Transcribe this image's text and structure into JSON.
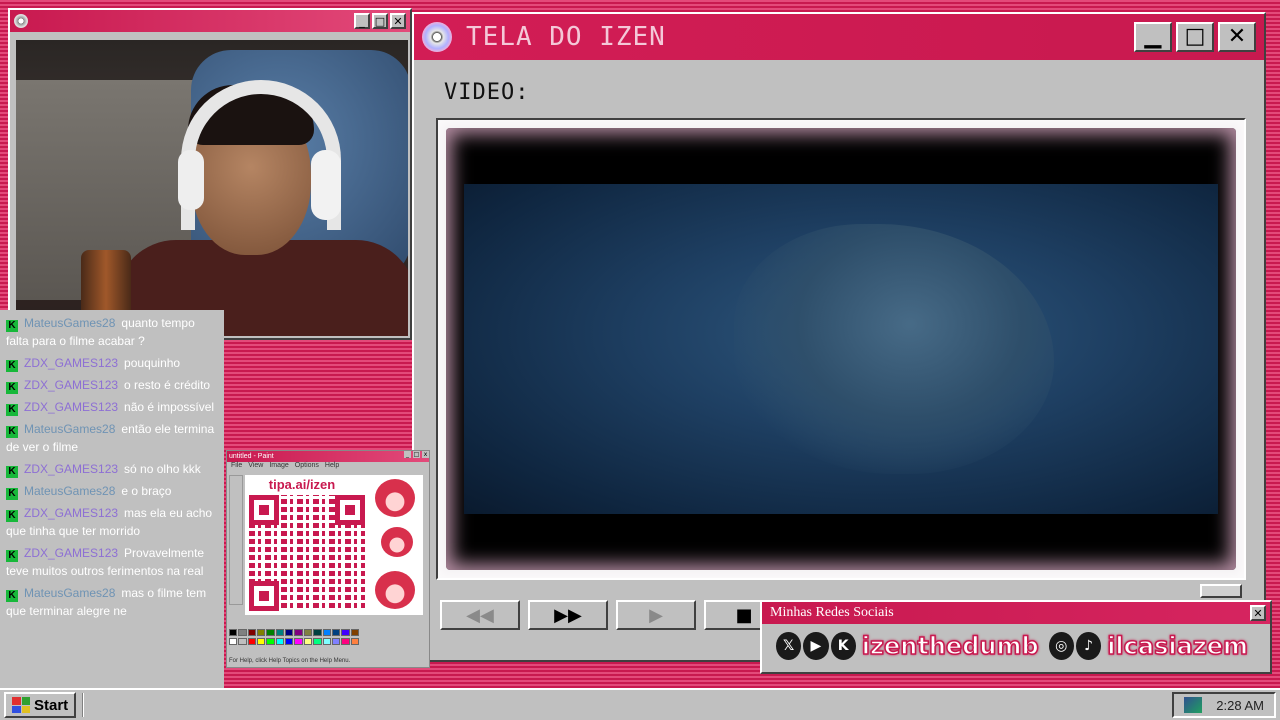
{
  "main_window": {
    "title": "TELA DO IZEN",
    "video_label": "VIDEO:",
    "controls": {
      "rewind": "◀◀",
      "fast_forward": "▶▶",
      "play": "▶",
      "stop": "■"
    }
  },
  "webcam_window": {
    "buttons": {
      "minimize": "_",
      "maximize": "□",
      "close": "✕"
    }
  },
  "chat": {
    "messages": [
      {
        "user": "MateusGames28",
        "text": "quanto tempo falta para o filme acabar ?"
      },
      {
        "user": "ZDX_GAMES123",
        "text": "pouquinho"
      },
      {
        "user": "ZDX_GAMES123",
        "text": "o resto é crédito"
      },
      {
        "user": "ZDX_GAMES123",
        "text": "não é impossível"
      },
      {
        "user": "MateusGames28",
        "text": "então ele termina de ver o filme"
      },
      {
        "user": "ZDX_GAMES123",
        "text": "só no olho kkk"
      },
      {
        "user": "MateusGames28",
        "text": "e o braço"
      },
      {
        "user": "ZDX_GAMES123",
        "text": "mas ela eu acho que tinha que ter morrido"
      },
      {
        "user": "ZDX_GAMES123",
        "text": "Provavelmente teve muitos outros ferimentos na real"
      },
      {
        "user": "MateusGames28",
        "text": "mas o filme tem que terminar alegre ne"
      }
    ],
    "badge": "K"
  },
  "paint": {
    "title": "untitled - Paint",
    "menu": [
      "File",
      "View",
      "Image",
      "Options",
      "Help"
    ],
    "url": "tipa.ai/izen",
    "status": "For Help, click Help Topics on the Help Menu."
  },
  "social": {
    "title": "Minhas Redes Sociais",
    "close": "✕",
    "handle_1": "izenthedumb",
    "handle_2": "ilcasiazem",
    "icons": [
      "x-icon",
      "youtube-icon",
      "kick-icon",
      "instagram-icon",
      "tiktok-icon"
    ]
  },
  "taskbar": {
    "start_label": "Start",
    "clock": "2:28 AM"
  },
  "colors": {
    "accent": "#c8194f",
    "chat_user_a": "#6f93b4",
    "chat_user_b": "#8d6fd4",
    "kick_green": "#17b83a"
  }
}
